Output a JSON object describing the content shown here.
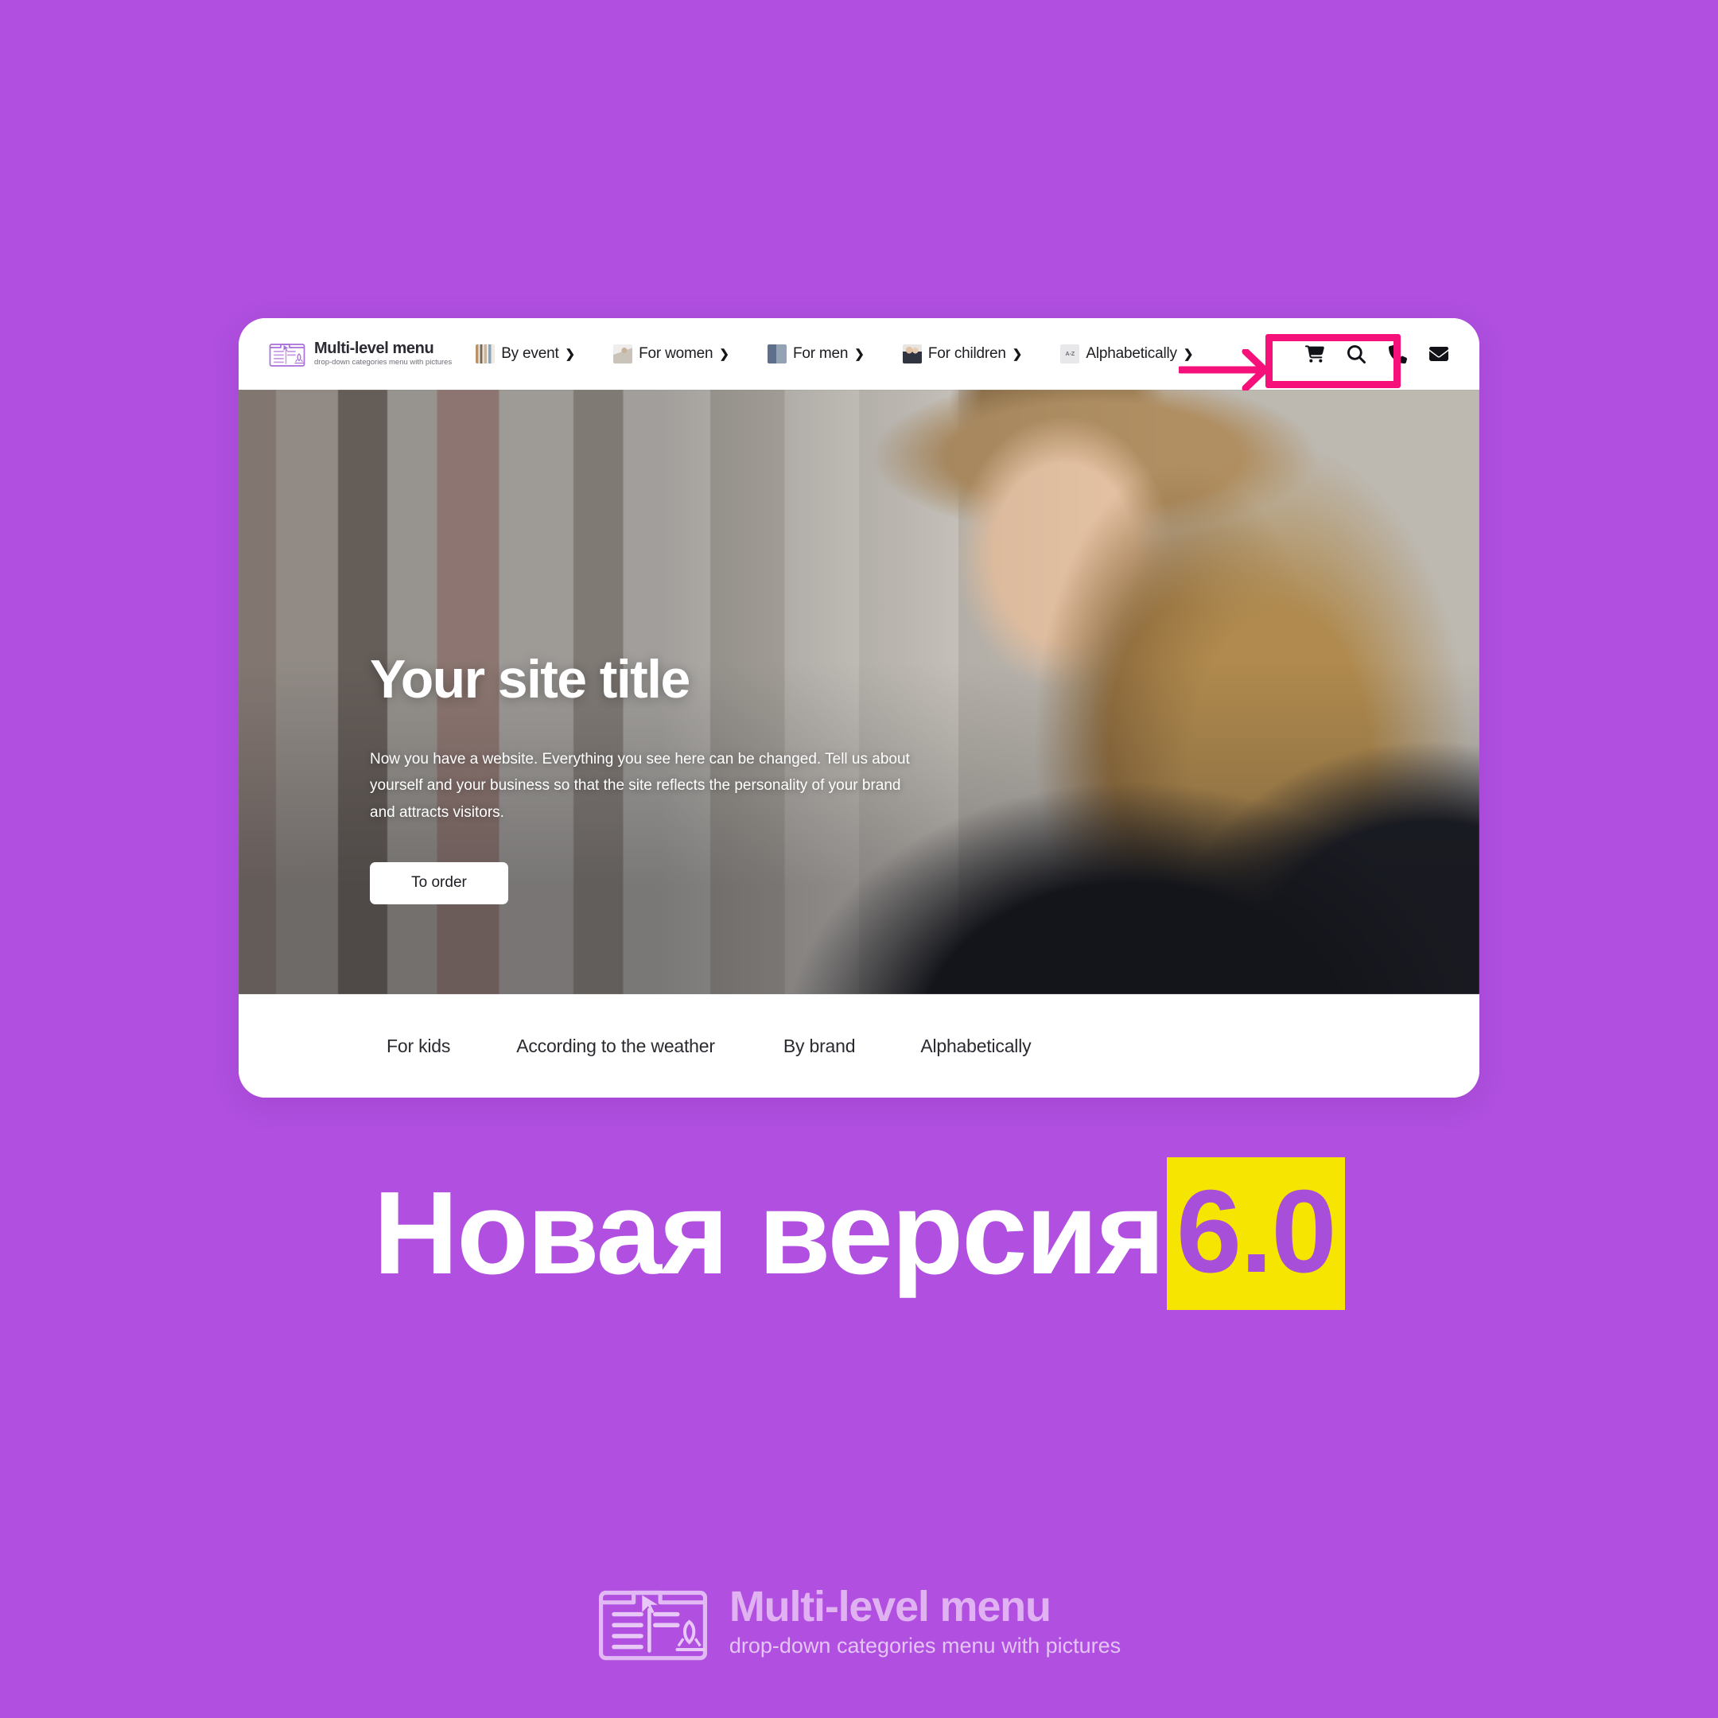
{
  "page": {
    "background_color": "#b04fe0",
    "accent_highlight_color": "#f5107a",
    "badge_background_color": "#f5e500",
    "badge_text_color": "#a74fd8"
  },
  "browser": {
    "nav": {
      "brand": {
        "title": "Multi-level menu",
        "subtitle": "drop-down categories menu with pictures",
        "icon": "multi-level-menu-logo-icon"
      },
      "items": [
        {
          "label": "By event",
          "caret": "❯",
          "thumb": "event-thumbnail"
        },
        {
          "label": "For women",
          "caret": "❯",
          "thumb": "women-thumbnail"
        },
        {
          "label": "For men",
          "caret": "❯",
          "thumb": "men-thumbnail"
        },
        {
          "label": "For children",
          "caret": "❯",
          "thumb": "children-thumbnail"
        },
        {
          "label": "Alphabetically",
          "caret": "❯",
          "thumb": "alphabet-thumbnail"
        }
      ],
      "action_icons": [
        {
          "name": "cart-icon"
        },
        {
          "name": "search-icon"
        },
        {
          "name": "phone-icon"
        },
        {
          "name": "envelope-icon"
        }
      ]
    },
    "hero": {
      "title": "Your site title",
      "description": "Now you have a website. Everything you see here can be changed. Tell us about yourself and your business so that the site reflects the personality of your brand and attracts visitors.",
      "button_label": "To order"
    },
    "bottom_menu": {
      "items": [
        {
          "label": "For kids"
        },
        {
          "label": "According to the weather"
        },
        {
          "label": "By brand"
        },
        {
          "label": "Alphabetically"
        }
      ]
    }
  },
  "headline": {
    "text": "Новая версия",
    "badge": "6.0"
  },
  "footer": {
    "title": "Multi-level menu",
    "subtitle": "drop-down categories menu with pictures",
    "icon": "multi-level-menu-logo-icon"
  }
}
